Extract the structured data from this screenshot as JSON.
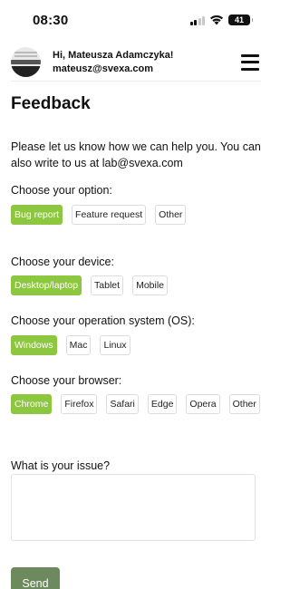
{
  "status_bar": {
    "time": "08:30",
    "battery": "41"
  },
  "header": {
    "greeting": "Hi, Mateusza Adamczyka!",
    "email": "mateusz@svexa.com"
  },
  "page": {
    "title": "Feedback",
    "intro": "Please let us know how we can help you. You can also write to us at lab@svexa.com"
  },
  "sections": {
    "option": {
      "label": "Choose your option:",
      "choices": [
        "Bug report",
        "Feature request",
        "Other"
      ],
      "selected": "Bug report"
    },
    "device": {
      "label": "Choose your device:",
      "choices": [
        "Desktop/laptop",
        "Tablet",
        "Mobile"
      ],
      "selected": "Desktop/laptop"
    },
    "os": {
      "label": "Choose your operation system (OS):",
      "choices": [
        "Windows",
        "Mac",
        "Linux"
      ],
      "selected": "Windows"
    },
    "browser": {
      "label": "Choose your browser:",
      "choices": [
        "Chrome",
        "Firefox",
        "Safari",
        "Edge",
        "Opera",
        "Other"
      ],
      "selected": "Chrome"
    }
  },
  "issue": {
    "label": "What is your issue?",
    "value": "",
    "placeholder": ""
  },
  "send_label": "Send",
  "colors": {
    "selected_chip": "#8dc63f",
    "send_button": "#6d8a5f"
  },
  "icons": {
    "menu": "hamburger-menu-icon",
    "wifi": "wifi-icon",
    "signal": "cellular-signal-icon",
    "battery": "battery-icon"
  }
}
